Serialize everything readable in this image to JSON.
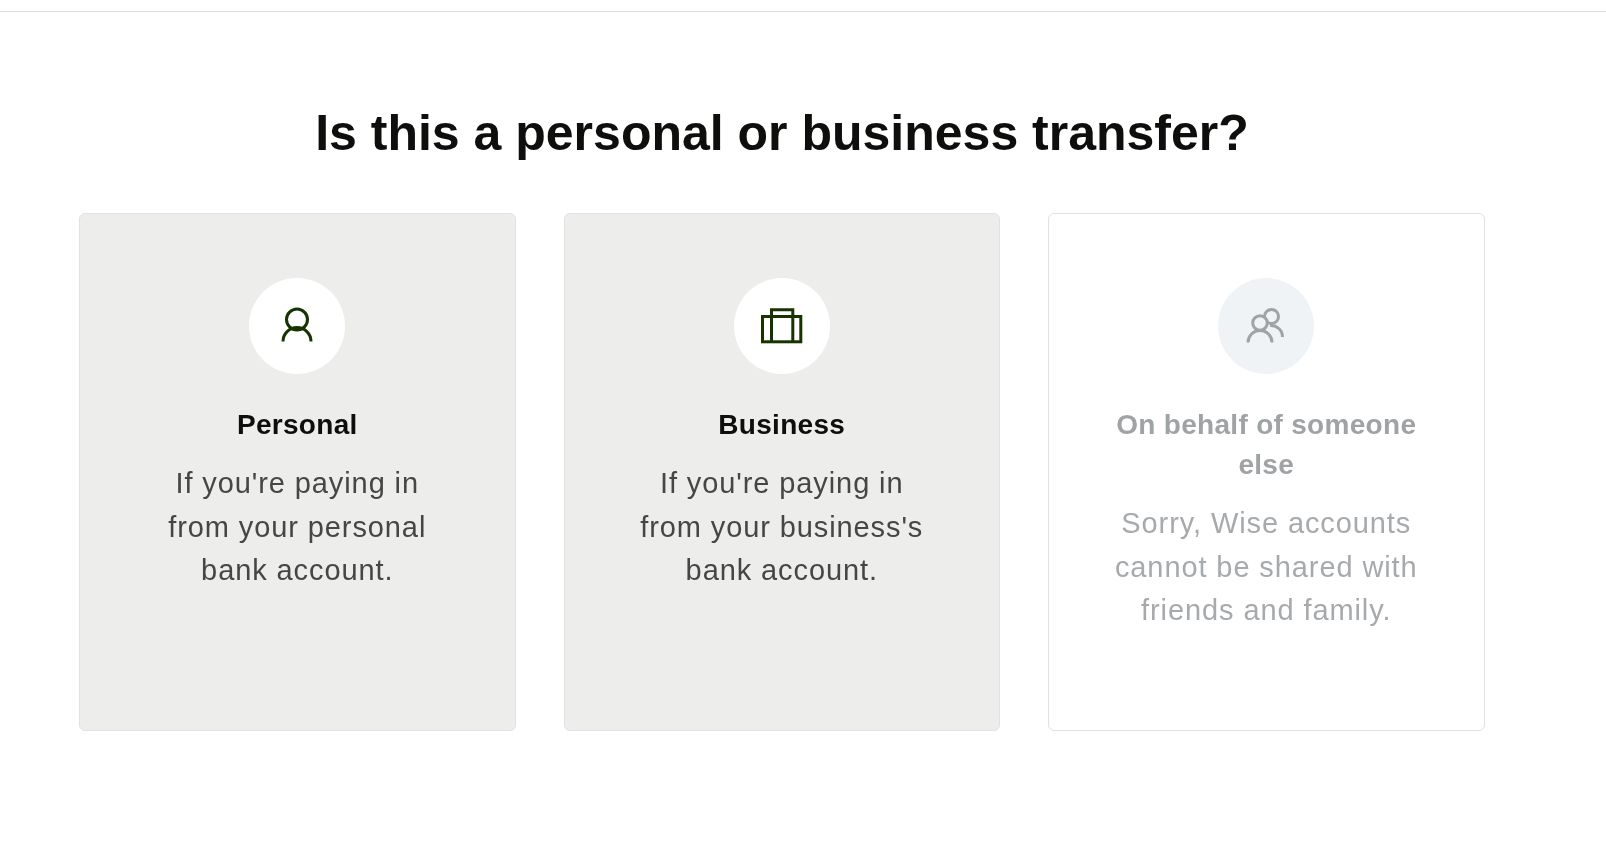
{
  "heading": "Is this a personal or business transfer?",
  "options": [
    {
      "kind": "personal",
      "title": "Personal",
      "description": "If you're paying in from your personal bank account.",
      "disabled": false
    },
    {
      "kind": "business",
      "title": "Business",
      "description": "If you're paying in from your business's bank account.",
      "disabled": false
    },
    {
      "kind": "group",
      "title": "On behalf of someone else",
      "description": "Sorry, Wise accounts cannot be shared with friends and family.",
      "disabled": true
    }
  ]
}
